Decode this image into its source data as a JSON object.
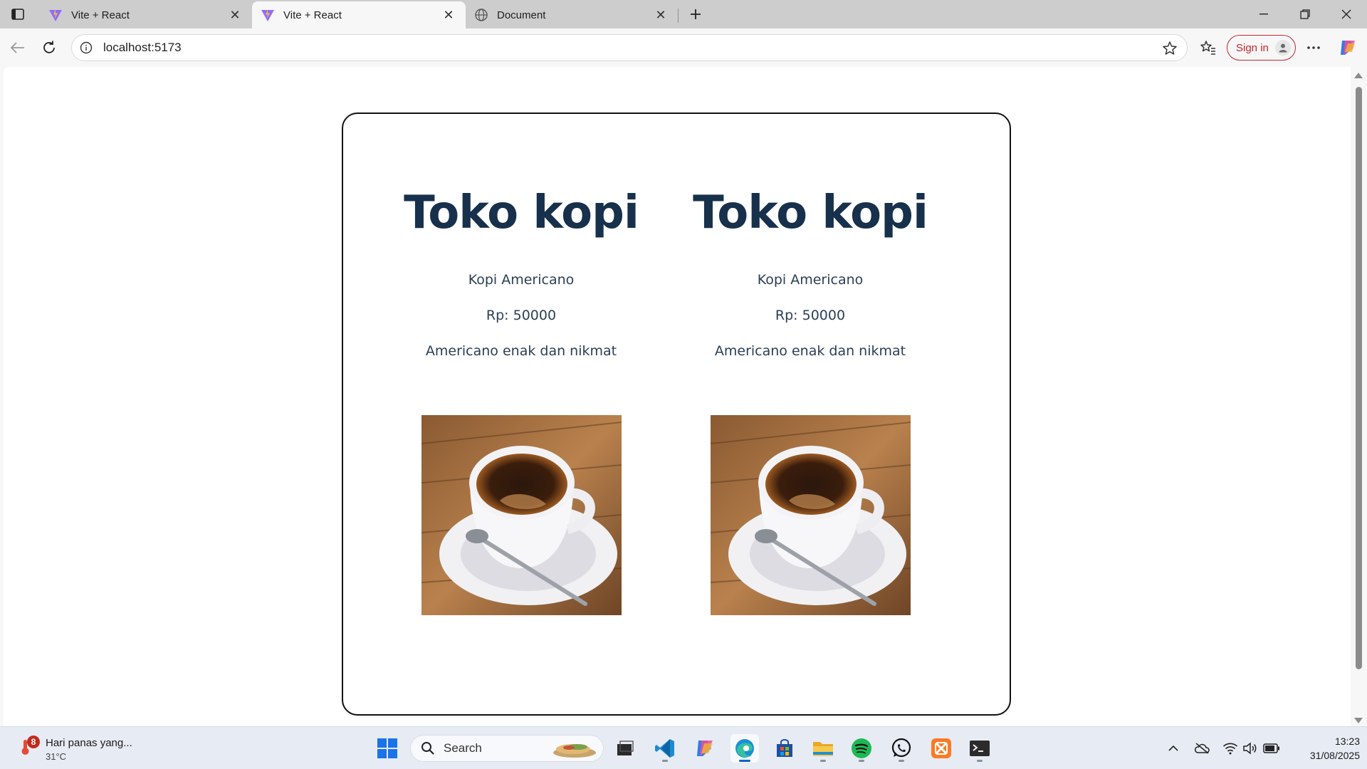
{
  "browser": {
    "tabs": [
      {
        "title": "Vite + React",
        "state": "inactive"
      },
      {
        "title": "Vite + React",
        "state": "active"
      },
      {
        "title": "Document",
        "state": "inactive"
      }
    ],
    "address_bar": {
      "url": "localhost:5173"
    },
    "sign_in_label": "Sign in",
    "accent_color": "#c4262f"
  },
  "page": {
    "products": [
      {
        "shop_title": "Toko kopi",
        "name": "Kopi Americano",
        "price": "Rp: 50000",
        "description": "Americano enak dan nikmat",
        "image_icon": "coffee-cup-photo"
      },
      {
        "shop_title": "Toko kopi",
        "name": "Kopi Americano",
        "price": "Rp: 50000",
        "description": "Americano enak dan nikmat",
        "image_icon": "coffee-cup-photo"
      }
    ],
    "heading_color": "#17304b",
    "border_color": "#111111"
  },
  "taskbar": {
    "weather": {
      "title": "Hari panas yang...",
      "temperature": "31°C",
      "badge": "8"
    },
    "search_label": "Search",
    "clock": {
      "time": "13:23",
      "date": "31/08/2025"
    }
  }
}
